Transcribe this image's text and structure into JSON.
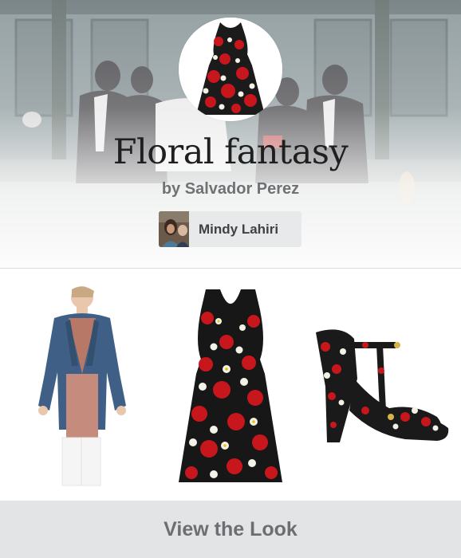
{
  "look": {
    "title": "Floral fantasy",
    "byline": "by Salvador Perez"
  },
  "user": {
    "name": "Mindy Lahiri"
  },
  "products": [
    {
      "icon": "denim-jacket-outfit-image"
    },
    {
      "icon": "floral-dress-image"
    },
    {
      "icon": "floral-heel-sandal-image"
    }
  ],
  "footer": {
    "cta_label": "View the Look"
  },
  "colors": {
    "title": "#1f1f1f",
    "byline": "#6f7174",
    "footer_bg": "#e3e4e5",
    "footer_text": "#6c6e71"
  }
}
